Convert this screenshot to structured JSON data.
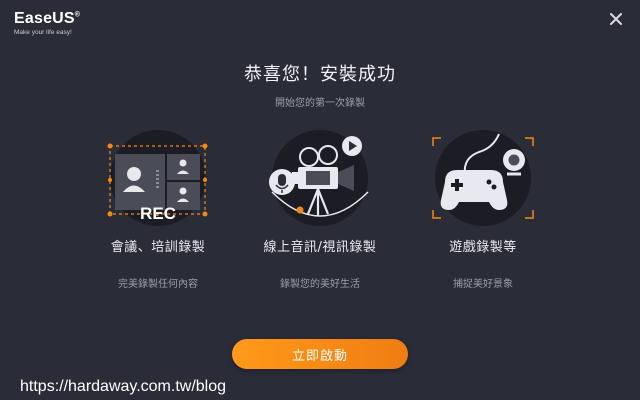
{
  "app": {
    "logo_name": "EaseUS",
    "logo_mark": "®",
    "logo_tagline": "Make your life easy!"
  },
  "header": {
    "title": "恭喜您！安裝成功",
    "subtitle": "開始您的第一次錄製"
  },
  "features": [
    {
      "label": "會議、培訓錄製",
      "desc": "完美錄製任何內容",
      "art_text": "REC",
      "icon": "screen-record-icon"
    },
    {
      "label": "線上音訊/視訊錄製",
      "desc": "錄製您的美好生活",
      "icon": "video-camera-icon"
    },
    {
      "label": "遊戲錄製等",
      "desc": "捕捉美好景象",
      "icon": "gamepad-icon"
    }
  ],
  "actions": {
    "start_label": "立即啟動"
  },
  "watermark": "https://hardaway.com.tw/blog",
  "colors": {
    "background": "#2a2c38",
    "accent": "#f58a14",
    "circle": "#1b1c24"
  }
}
